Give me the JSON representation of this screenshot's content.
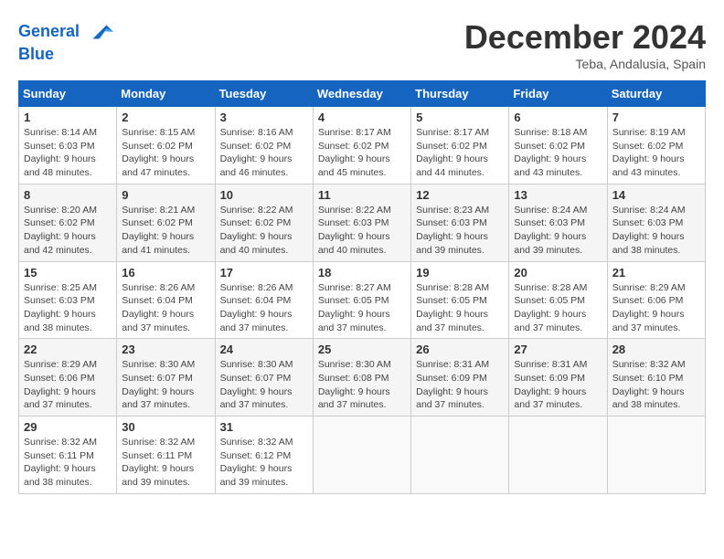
{
  "header": {
    "logo_line1": "General",
    "logo_line2": "Blue",
    "month_title": "December 2024",
    "subtitle": "Teba, Andalusia, Spain"
  },
  "weekdays": [
    "Sunday",
    "Monday",
    "Tuesday",
    "Wednesday",
    "Thursday",
    "Friday",
    "Saturday"
  ],
  "weeks": [
    [
      {
        "day": "1",
        "info": "Sunrise: 8:14 AM\nSunset: 6:03 PM\nDaylight: 9 hours\nand 48 minutes."
      },
      {
        "day": "2",
        "info": "Sunrise: 8:15 AM\nSunset: 6:02 PM\nDaylight: 9 hours\nand 47 minutes."
      },
      {
        "day": "3",
        "info": "Sunrise: 8:16 AM\nSunset: 6:02 PM\nDaylight: 9 hours\nand 46 minutes."
      },
      {
        "day": "4",
        "info": "Sunrise: 8:17 AM\nSunset: 6:02 PM\nDaylight: 9 hours\nand 45 minutes."
      },
      {
        "day": "5",
        "info": "Sunrise: 8:17 AM\nSunset: 6:02 PM\nDaylight: 9 hours\nand 44 minutes."
      },
      {
        "day": "6",
        "info": "Sunrise: 8:18 AM\nSunset: 6:02 PM\nDaylight: 9 hours\nand 43 minutes."
      },
      {
        "day": "7",
        "info": "Sunrise: 8:19 AM\nSunset: 6:02 PM\nDaylight: 9 hours\nand 43 minutes."
      }
    ],
    [
      {
        "day": "8",
        "info": "Sunrise: 8:20 AM\nSunset: 6:02 PM\nDaylight: 9 hours\nand 42 minutes."
      },
      {
        "day": "9",
        "info": "Sunrise: 8:21 AM\nSunset: 6:02 PM\nDaylight: 9 hours\nand 41 minutes."
      },
      {
        "day": "10",
        "info": "Sunrise: 8:22 AM\nSunset: 6:02 PM\nDaylight: 9 hours\nand 40 minutes."
      },
      {
        "day": "11",
        "info": "Sunrise: 8:22 AM\nSunset: 6:03 PM\nDaylight: 9 hours\nand 40 minutes."
      },
      {
        "day": "12",
        "info": "Sunrise: 8:23 AM\nSunset: 6:03 PM\nDaylight: 9 hours\nand 39 minutes."
      },
      {
        "day": "13",
        "info": "Sunrise: 8:24 AM\nSunset: 6:03 PM\nDaylight: 9 hours\nand 39 minutes."
      },
      {
        "day": "14",
        "info": "Sunrise: 8:24 AM\nSunset: 6:03 PM\nDaylight: 9 hours\nand 38 minutes."
      }
    ],
    [
      {
        "day": "15",
        "info": "Sunrise: 8:25 AM\nSunset: 6:03 PM\nDaylight: 9 hours\nand 38 minutes."
      },
      {
        "day": "16",
        "info": "Sunrise: 8:26 AM\nSunset: 6:04 PM\nDaylight: 9 hours\nand 37 minutes."
      },
      {
        "day": "17",
        "info": "Sunrise: 8:26 AM\nSunset: 6:04 PM\nDaylight: 9 hours\nand 37 minutes."
      },
      {
        "day": "18",
        "info": "Sunrise: 8:27 AM\nSunset: 6:05 PM\nDaylight: 9 hours\nand 37 minutes."
      },
      {
        "day": "19",
        "info": "Sunrise: 8:28 AM\nSunset: 6:05 PM\nDaylight: 9 hours\nand 37 minutes."
      },
      {
        "day": "20",
        "info": "Sunrise: 8:28 AM\nSunset: 6:05 PM\nDaylight: 9 hours\nand 37 minutes."
      },
      {
        "day": "21",
        "info": "Sunrise: 8:29 AM\nSunset: 6:06 PM\nDaylight: 9 hours\nand 37 minutes."
      }
    ],
    [
      {
        "day": "22",
        "info": "Sunrise: 8:29 AM\nSunset: 6:06 PM\nDaylight: 9 hours\nand 37 minutes."
      },
      {
        "day": "23",
        "info": "Sunrise: 8:30 AM\nSunset: 6:07 PM\nDaylight: 9 hours\nand 37 minutes."
      },
      {
        "day": "24",
        "info": "Sunrise: 8:30 AM\nSunset: 6:07 PM\nDaylight: 9 hours\nand 37 minutes."
      },
      {
        "day": "25",
        "info": "Sunrise: 8:30 AM\nSunset: 6:08 PM\nDaylight: 9 hours\nand 37 minutes."
      },
      {
        "day": "26",
        "info": "Sunrise: 8:31 AM\nSunset: 6:09 PM\nDaylight: 9 hours\nand 37 minutes."
      },
      {
        "day": "27",
        "info": "Sunrise: 8:31 AM\nSunset: 6:09 PM\nDaylight: 9 hours\nand 37 minutes."
      },
      {
        "day": "28",
        "info": "Sunrise: 8:32 AM\nSunset: 6:10 PM\nDaylight: 9 hours\nand 38 minutes."
      }
    ],
    [
      {
        "day": "29",
        "info": "Sunrise: 8:32 AM\nSunset: 6:11 PM\nDaylight: 9 hours\nand 38 minutes."
      },
      {
        "day": "30",
        "info": "Sunrise: 8:32 AM\nSunset: 6:11 PM\nDaylight: 9 hours\nand 39 minutes."
      },
      {
        "day": "31",
        "info": "Sunrise: 8:32 AM\nSunset: 6:12 PM\nDaylight: 9 hours\nand 39 minutes."
      },
      {
        "day": "",
        "info": ""
      },
      {
        "day": "",
        "info": ""
      },
      {
        "day": "",
        "info": ""
      },
      {
        "day": "",
        "info": ""
      }
    ]
  ]
}
